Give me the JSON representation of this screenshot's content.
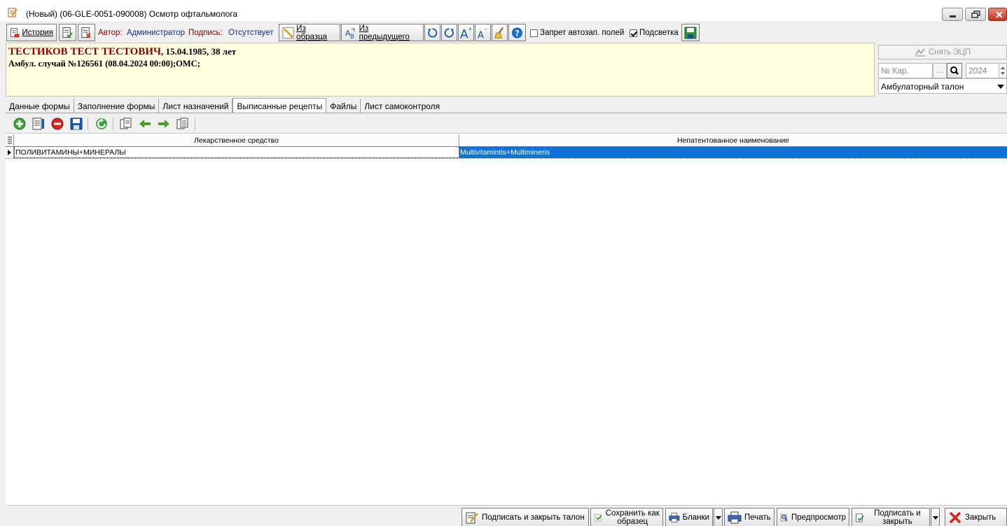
{
  "window": {
    "title": "(Новый) (06-GLE-0051-090008) Осмотр офтальмолога"
  },
  "toolbar": {
    "history_label": "История",
    "author_label": "Автор:",
    "author_value": "Администратор",
    "signature_label": "Подпись:",
    "signature_value": "Отсутствует",
    "from_template_label": "Из образца",
    "from_previous_label": "Из предыдущего",
    "autofill_ban_label": "Запрет автозап. полей",
    "autofill_ban_checked": false,
    "highlight_label": "Подсветка",
    "highlight_checked": true
  },
  "patient": {
    "name": "ТЕСТИКОВ ТЕСТ ТЕСТОВИЧ",
    "dob_age": ", 15.04.1985, 38 лет",
    "case": "Амбул. случай №126561 (08.04.2024 00:00);ОМС;"
  },
  "side": {
    "remove_esign_label": "Снять ЭЦП",
    "card_placeholder": "№ Кар.",
    "dots": "…",
    "year": "2024",
    "document_type": "Амбулаторный талон"
  },
  "tabs": [
    {
      "label": "Данные формы",
      "active": false
    },
    {
      "label": "Заполнение формы",
      "active": false
    },
    {
      "label": "Лист назначений",
      "active": false
    },
    {
      "label": "Выписанные рецепты",
      "active": true
    },
    {
      "label": "Файлы",
      "active": false
    },
    {
      "label": "Лист самоконтроля",
      "active": false
    }
  ],
  "grid": {
    "columns": [
      "Лекарственное средство",
      "Непатентованное наименование"
    ],
    "rows": [
      [
        "ПОЛИВИТАМИНЫ+МИНЕРАЛЫ",
        "Multivitamintis+Multimineris"
      ]
    ]
  },
  "bottom": {
    "sign_close_label": "Подписать и закрыть талон",
    "save_as_template_label": "Сохранить как образец",
    "forms_label": "Бланки",
    "print_label": "Печать",
    "preview_label": "Предпросмотр",
    "sign_and_close_label": "Подписать и закрыть",
    "close_label": "Закрыть"
  },
  "colors": {
    "patient_bg": "#ffffe1",
    "patient_name": "#8b0000",
    "selection": "#0a73d9",
    "author_label": "#8b0000",
    "author_value": "#1a2a8c"
  }
}
